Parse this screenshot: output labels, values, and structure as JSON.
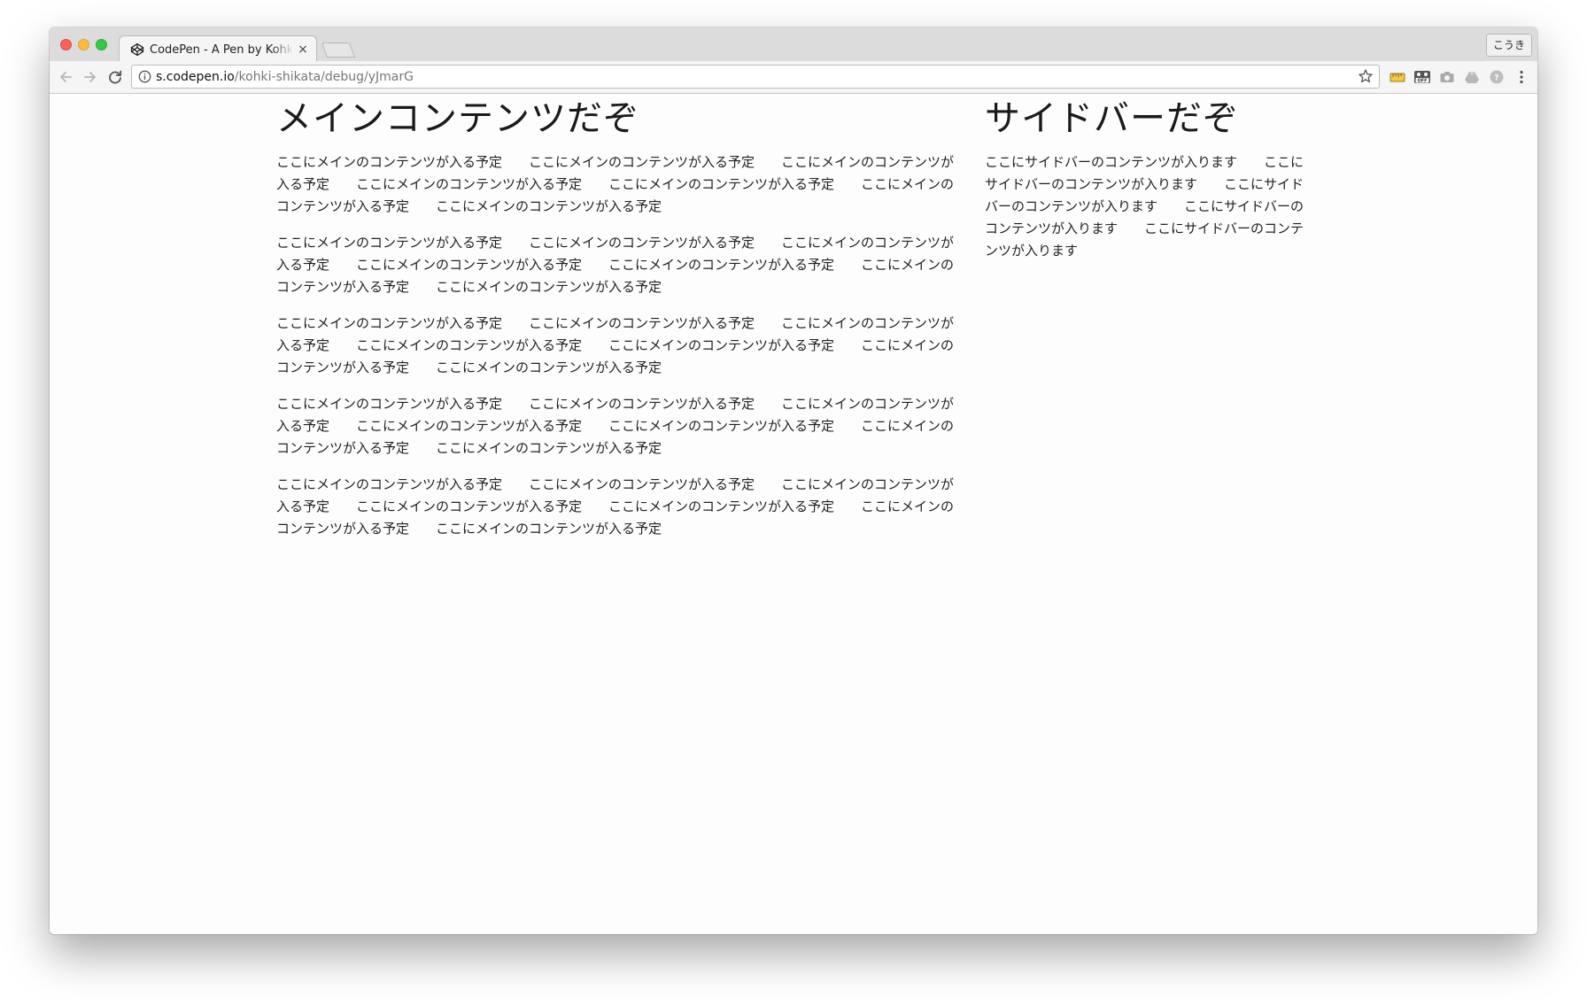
{
  "browser": {
    "tab_title": "CodePen - A Pen by Kohki SHIKATA",
    "tab_close": "×",
    "ime_label": "こうき",
    "url_host": "s.codepen.io",
    "url_path": "/kohki-shikata/debug/yJmarG",
    "icons": {
      "back": "back-arrow-icon",
      "forward": "forward-arrow-icon",
      "reload": "reload-icon",
      "info": "info-icon",
      "bookmark": "star-icon",
      "menu": "menu-icon"
    }
  },
  "main": {
    "heading": "メインコンテンツだぞ",
    "paragraphs": [
      "ここにメインのコンテンツが入る予定　　ここにメインのコンテンツが入る予定　　ここにメインのコンテンツが入る予定　　ここにメインのコンテンツが入る予定　　ここにメインのコンテンツが入る予定　　ここにメインのコンテンツが入る予定　　ここにメインのコンテンツが入る予定",
      "ここにメインのコンテンツが入る予定　　ここにメインのコンテンツが入る予定　　ここにメインのコンテンツが入る予定　　ここにメインのコンテンツが入る予定　　ここにメインのコンテンツが入る予定　　ここにメインのコンテンツが入る予定　　ここにメインのコンテンツが入る予定",
      "ここにメインのコンテンツが入る予定　　ここにメインのコンテンツが入る予定　　ここにメインのコンテンツが入る予定　　ここにメインのコンテンツが入る予定　　ここにメインのコンテンツが入る予定　　ここにメインのコンテンツが入る予定　　ここにメインのコンテンツが入る予定",
      "ここにメインのコンテンツが入る予定　　ここにメインのコンテンツが入る予定　　ここにメインのコンテンツが入る予定　　ここにメインのコンテンツが入る予定　　ここにメインのコンテンツが入る予定　　ここにメインのコンテンツが入る予定　　ここにメインのコンテンツが入る予定",
      "ここにメインのコンテンツが入る予定　　ここにメインのコンテンツが入る予定　　ここにメインのコンテンツが入る予定　　ここにメインのコンテンツが入る予定　　ここにメインのコンテンツが入る予定　　ここにメインのコンテンツが入る予定　　ここにメインのコンテンツが入る予定"
    ]
  },
  "sidebar": {
    "heading": "サイドバーだぞ",
    "paragraph": "ここにサイドバーのコンテンツが入ります　　ここにサイドバーのコンテンツが入ります　　ここにサイドバーのコンテンツが入ります　　ここにサイドバーのコンテンツが入ります　　ここにサイドバーのコンテンツが入ります"
  },
  "colors": {
    "window_bg": "#fdfdfd",
    "tabstrip_bg": "#dcdcdc",
    "text": "#222222"
  }
}
